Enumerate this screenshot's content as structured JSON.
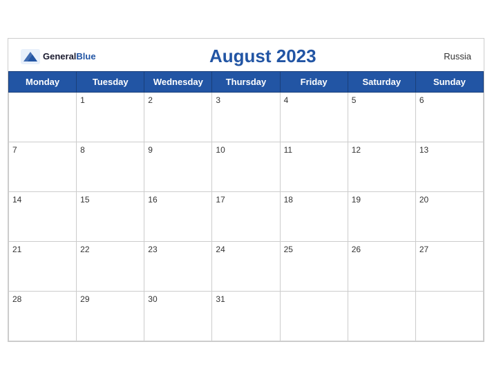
{
  "header": {
    "logo_general": "General",
    "logo_blue": "Blue",
    "title": "August 2023",
    "country": "Russia"
  },
  "weekdays": [
    "Monday",
    "Tuesday",
    "Wednesday",
    "Thursday",
    "Friday",
    "Saturday",
    "Sunday"
  ],
  "weeks": [
    [
      "",
      "1",
      "2",
      "3",
      "4",
      "5",
      "6"
    ],
    [
      "7",
      "8",
      "9",
      "10",
      "11",
      "12",
      "13"
    ],
    [
      "14",
      "15",
      "16",
      "17",
      "18",
      "19",
      "20"
    ],
    [
      "21",
      "22",
      "23",
      "24",
      "25",
      "26",
      "27"
    ],
    [
      "28",
      "29",
      "30",
      "31",
      "",
      "",
      ""
    ]
  ]
}
